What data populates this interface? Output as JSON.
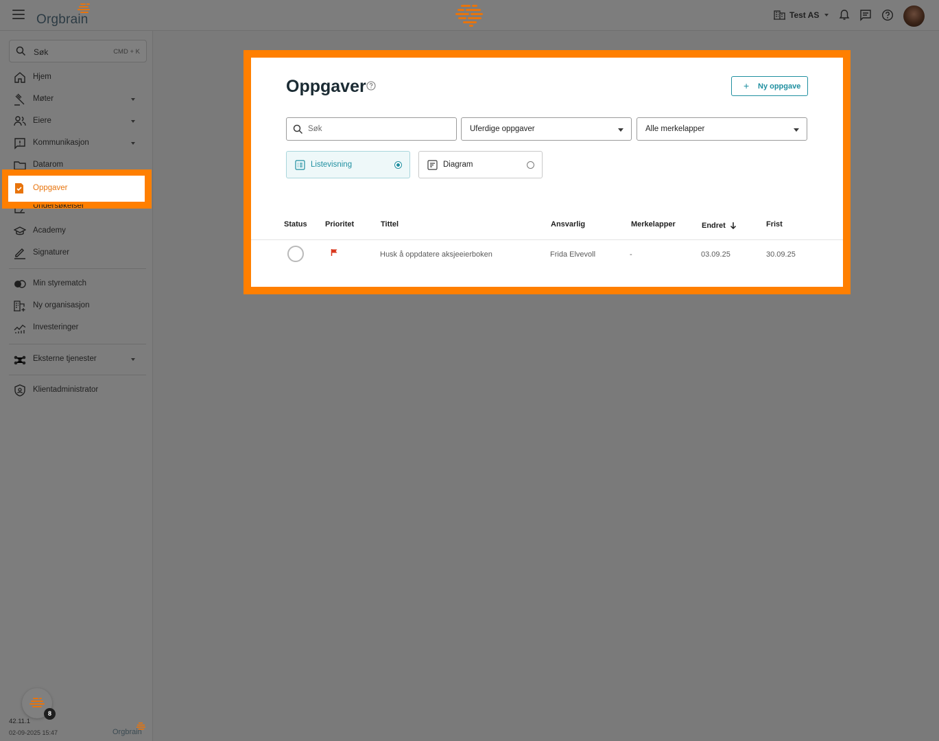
{
  "header": {
    "logo_text": "Orgbrain",
    "company": "Test AS"
  },
  "sidebar": {
    "search": {
      "placeholder": "Søk",
      "shortcut": "CMD + K"
    },
    "items": [
      {
        "label": "Hjem",
        "icon": "home-icon"
      },
      {
        "label": "Møter",
        "icon": "gavel-icon",
        "has_submenu": true
      },
      {
        "label": "Eiere",
        "icon": "people-icon",
        "has_submenu": true
      },
      {
        "label": "Kommunikasjon",
        "icon": "message-icon",
        "has_submenu": true
      },
      {
        "label": "Datarom",
        "icon": "folder-icon"
      },
      {
        "label": "Oppgaver",
        "icon": "task-icon",
        "active": true
      },
      {
        "label": "Undersøkelser",
        "icon": "survey-icon"
      },
      {
        "label": "Academy",
        "icon": "academy-icon"
      },
      {
        "label": "Signaturer",
        "icon": "pen-icon"
      }
    ],
    "items2": [
      {
        "label": "Min styrematch",
        "icon": "toggle-icon"
      },
      {
        "label": "Ny organisasjon",
        "icon": "building-add-icon"
      },
      {
        "label": "Investeringer",
        "icon": "chart-icon"
      }
    ],
    "items3": [
      {
        "label": "Eksterne tjenester",
        "icon": "network-icon",
        "has_submenu": true
      }
    ],
    "items4": [
      {
        "label": "Klientadministrator",
        "icon": "shield-icon"
      }
    ],
    "badge_count": "8",
    "version": "42.11.1",
    "build_date": "02-09-2025 15:47",
    "footer_logo": "Orgbrain"
  },
  "main": {
    "title": "Oppgaver",
    "new_button": "Ny oppgave",
    "search_placeholder": "Søk",
    "status_filter": "Uferdige oppgaver",
    "tag_filter": "Alle merkelapper",
    "views": [
      {
        "label": "Listevisning",
        "selected": true
      },
      {
        "label": "Diagram",
        "selected": false
      }
    ],
    "columns": [
      "Status",
      "Prioritet",
      "Tittel",
      "Ansvarlig",
      "Merkelapper",
      "Endret",
      "Frist"
    ],
    "rows": [
      {
        "title": "Husk å oppdatere aksjeeierboken",
        "responsible": "Frida Elvevoll",
        "tags": "-",
        "changed": "03.09.25",
        "due": "30.09.25"
      }
    ]
  },
  "colors": {
    "accent": "#1f8fa0",
    "highlight": "#ff7f00",
    "brand_orange": "#e8740c",
    "priority_flag": "#d9381e"
  }
}
